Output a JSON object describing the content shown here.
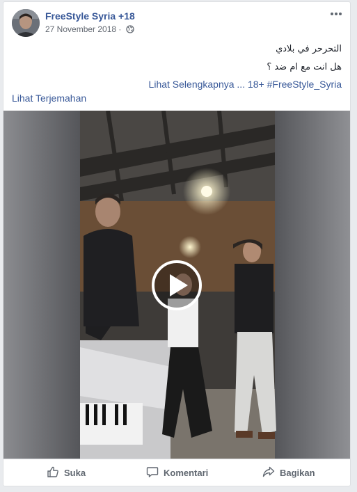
{
  "post": {
    "author": "FreeStyle Syria +18",
    "date": "27 November 2018 ·",
    "text_line1": "التحرحر في بلادي",
    "text_line2": "هل انت مع ام ضد ؟",
    "see_more": "Lihat Selengkapnya ... 18+ #FreeStyle_Syria",
    "translate": "Lihat Terjemahan"
  },
  "actions": {
    "like": "Suka",
    "comment": "Komentari",
    "share": "Bagikan"
  },
  "colors": {
    "link": "#385898",
    "text": "#1d2129",
    "meta": "#616770",
    "action": "#606770"
  },
  "icons": [
    "globe-icon",
    "more-options-icon",
    "play-icon",
    "like-icon",
    "comment-icon",
    "share-icon"
  ]
}
